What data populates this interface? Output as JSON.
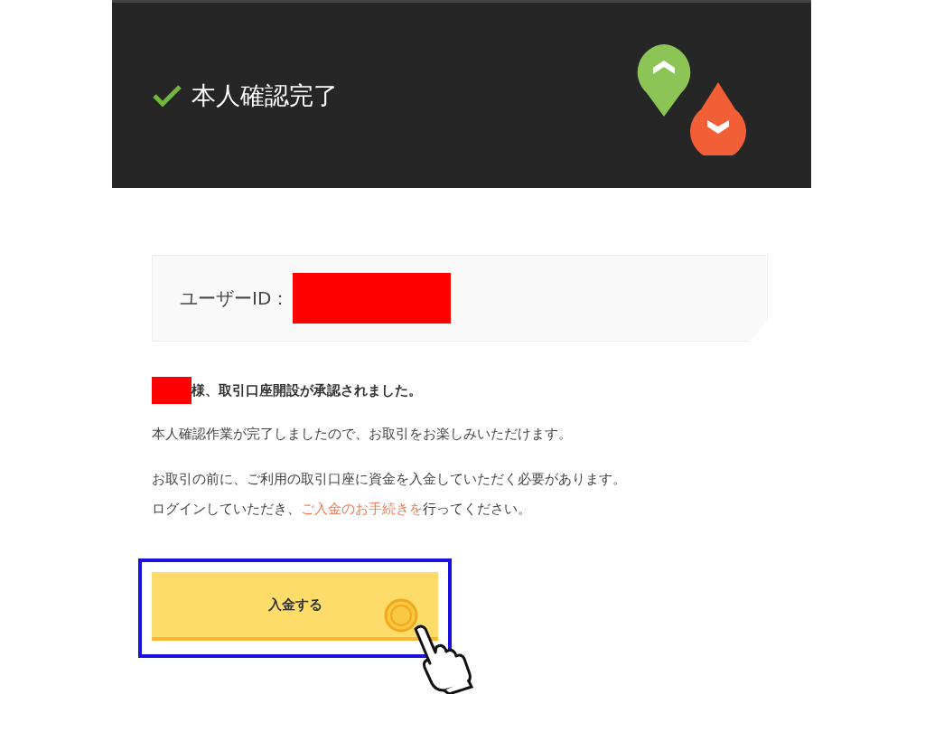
{
  "header": {
    "title": "本人確認完了"
  },
  "user_id": {
    "label": "ユーザーID："
  },
  "approval": {
    "text": "様、取引口座開設が承認されました。"
  },
  "message": "本人確認作業が完了しましたので、お取引をお楽しみいただけます。",
  "notice": {
    "line1": "お取引の前に、ご利用の取引口座に資金を入金していただく必要があります。",
    "before": "ログインしていただき、",
    "link": "ご入金のお手続きを",
    "after": "行ってください。"
  },
  "button": {
    "label": "入金する"
  }
}
